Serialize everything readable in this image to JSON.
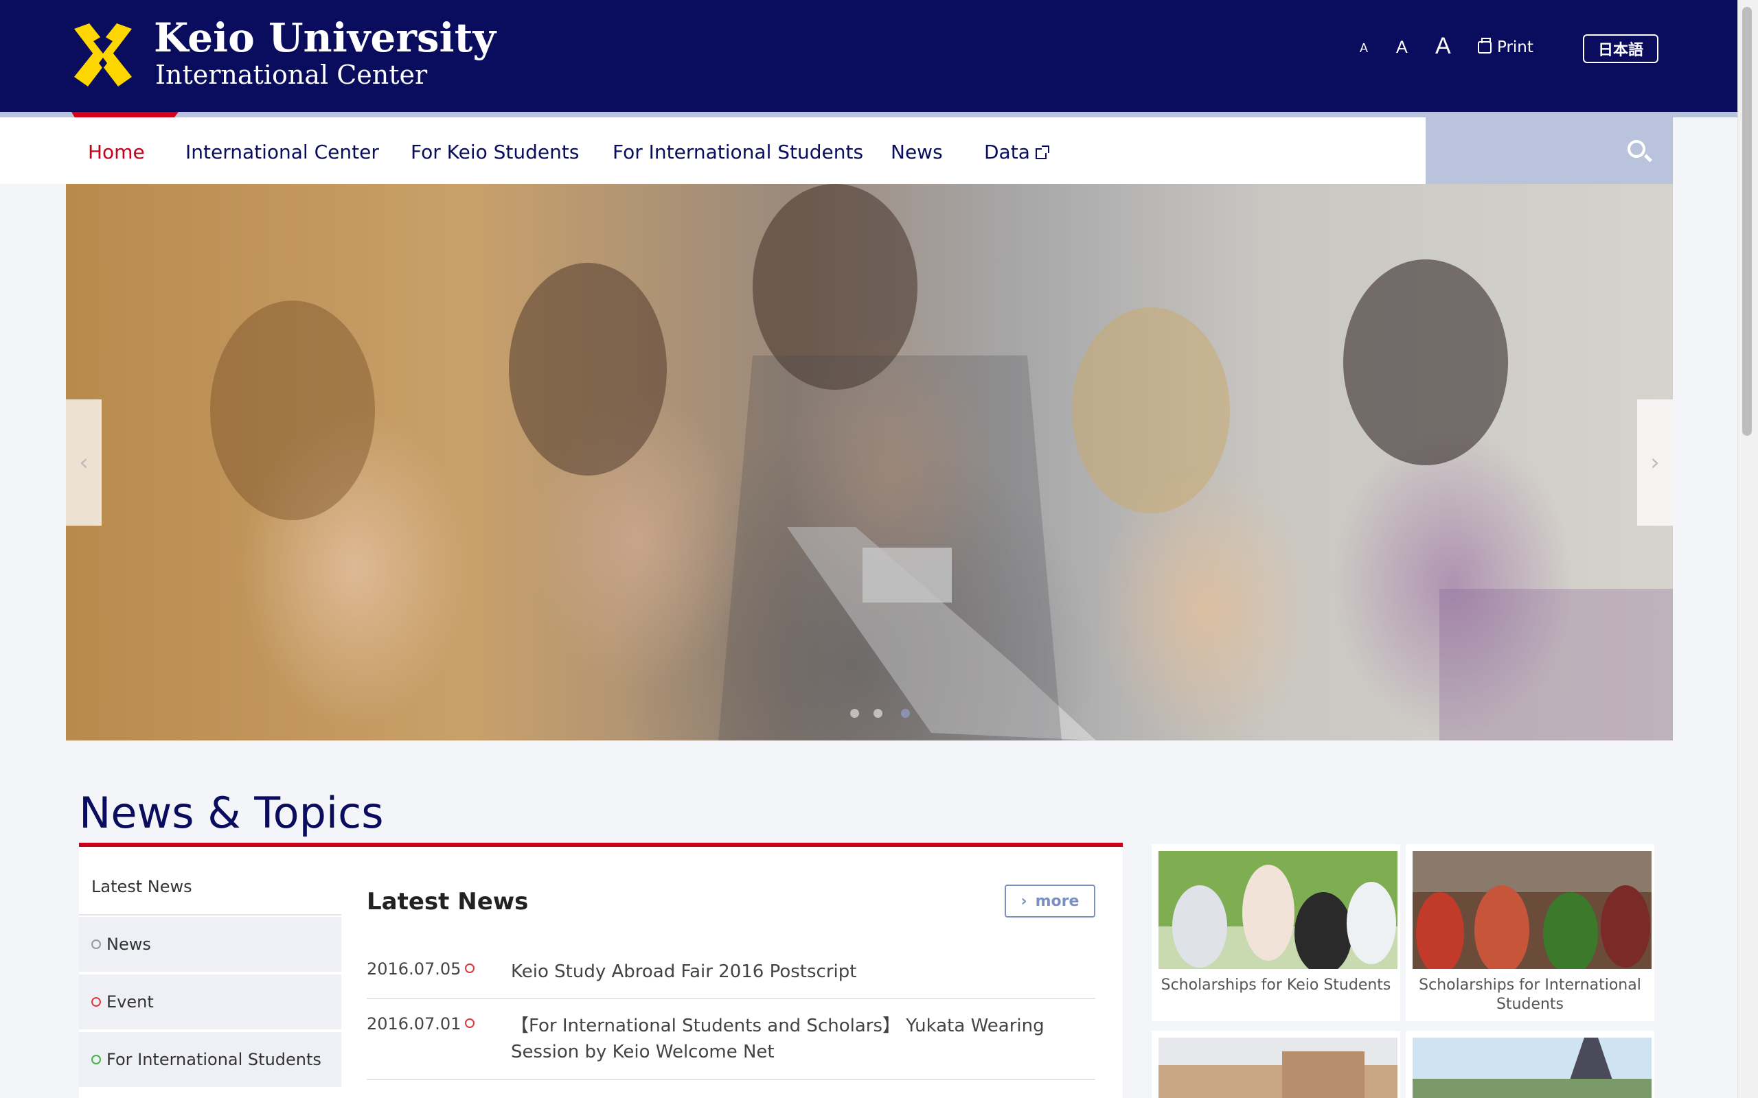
{
  "header": {
    "logo_title": "Keio University",
    "logo_subtitle": "International Center",
    "font_sizes": [
      "A",
      "A",
      "A"
    ],
    "print_label": "Print",
    "lang_label": "日本語"
  },
  "nav": {
    "items": [
      "Home",
      "International Center",
      "For Keio Students",
      "For International Students",
      "News",
      "Data"
    ],
    "active": "Home"
  },
  "hero": {
    "prev": "‹",
    "next": "›",
    "slides": 3,
    "active_slide": 3
  },
  "news_section": {
    "title": "News & Topics",
    "tabs": [
      "Latest News",
      "News",
      "Event",
      "For International Students"
    ],
    "latest_title": "Latest News",
    "more_label": "more",
    "items": [
      {
        "date": "2016.07.05",
        "text": "Keio Study Abroad Fair 2016 Postscript"
      },
      {
        "date": "2016.07.01",
        "text": "【For International Students and Scholars】 Yukata Wearing Session by Keio Welcome Net"
      }
    ]
  },
  "cards": [
    {
      "label": "Scholarships for Keio Students"
    },
    {
      "label": "Scholarships for International Students"
    }
  ],
  "colors": {
    "brand_navy": "#0a0c5d",
    "accent_red": "#c8001a",
    "logo_yellow": "#ffd700",
    "nav_search_bg": "#b9c3dc"
  }
}
